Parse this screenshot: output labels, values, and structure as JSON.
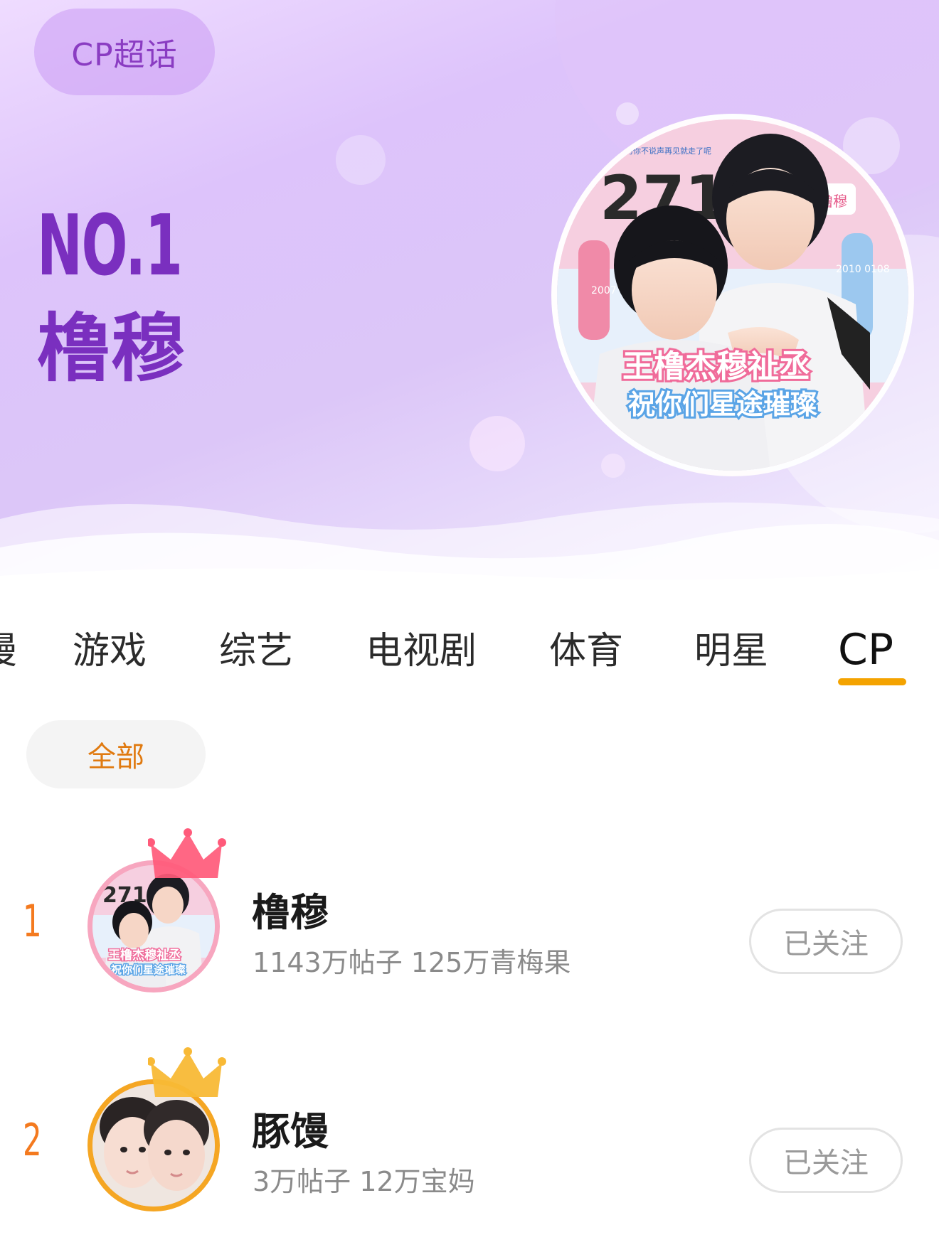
{
  "hero": {
    "chip_label": "CP超话",
    "rank_label": "NO.1",
    "name": "橹穆",
    "avatar_texts": {
      "big_number": "2711",
      "tag": "橹穆",
      "left_date": "2007 1116",
      "right_date": "2010 0108",
      "caption_line1": "王橹杰穆祉丞",
      "caption_line2": "祝你们星途璀璨",
      "top_note": "努力你不说声再见就走了呢"
    }
  },
  "tabs": [
    {
      "label": "漫",
      "active": false
    },
    {
      "label": "游戏",
      "active": false
    },
    {
      "label": "综艺",
      "active": false
    },
    {
      "label": "电视剧",
      "active": false
    },
    {
      "label": "体育",
      "active": false
    },
    {
      "label": "明星",
      "active": false
    },
    {
      "label": "CP",
      "active": true
    }
  ],
  "filter": {
    "label": "全部"
  },
  "ranking": [
    {
      "rank": "1",
      "name": "橹穆",
      "stats": "1143万帖子 125万青梅果",
      "follow_label": "已关注",
      "avatar_ring_color": "#f7a6bf",
      "crown_color": "#ff5a7a",
      "avatar_texts": {
        "big_number": "2711",
        "caption_line1": "王橹杰穆祉丞",
        "caption_line2": "祝你们星途璀璨"
      }
    },
    {
      "rank": "2",
      "name": "豚馒",
      "stats": "3万帖子 12万宝妈",
      "follow_label": "已关注",
      "avatar_ring_color": "#f5a623",
      "crown_color": "#f8b936"
    }
  ],
  "colors": {
    "accent_purple": "#7a2fbf",
    "tab_underline": "#f4a300",
    "rank_orange": "#f47a1f",
    "filter_text": "#e07a10"
  }
}
